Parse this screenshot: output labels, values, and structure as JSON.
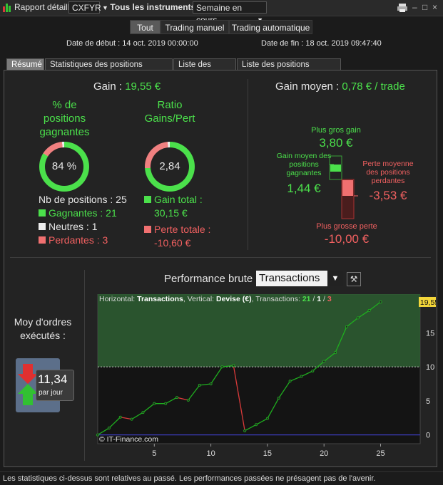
{
  "titlebar": {
    "title": "Rapport détaillé",
    "symbol": "CXFYR",
    "instruments": "Tous les instruments",
    "period": "Semaine en cours"
  },
  "filters": [
    "Tout",
    "Trading manuel",
    "Trading automatique"
  ],
  "dates": {
    "start": "Date de début : 14 oct. 2019 00:00:00",
    "end": "Date de fin : 18 oct. 2019 09:47:40"
  },
  "tabs": [
    "Résumé",
    "Statistiques des positions clôturées",
    "Liste des ordres",
    "Liste des positions clôturées"
  ],
  "summary": {
    "gain_label": "Gain :",
    "gain_value": "19,55 €",
    "pct_title": "% de positions gagnantes",
    "pct_value": "84 %",
    "pct_fraction": 0.84,
    "ratio_title": "Ratio Gains/Pert",
    "ratio_value": "2,84",
    "ratio_fraction": 0.74,
    "nb_positions": "Nb de positions : 25",
    "gagnantes": "Gagnantes : 21",
    "neutres": "Neutres : 1",
    "perdantes": "Perdantes : 3",
    "gain_total_label": "Gain total :",
    "gain_total_value": "30,15 €",
    "perte_totale_label": "Perte totale :",
    "perte_totale_value": "-10,60 €"
  },
  "gain_moyen": {
    "label": "Gain moyen :",
    "value": "0,78 € / trade",
    "plus_gros_gain_label": "Plus gros gain",
    "plus_gros_gain_value": "3,80 €",
    "gain_moyen_gagnantes_label": "Gain moyen des positions gagnantes",
    "gain_moyen_gagnantes_value": "1,44 €",
    "perte_moyenne_label": "Perte moyenne des positions perdantes",
    "perte_moyenne_value": "-3,53 €",
    "plus_grosse_perte_label": "Plus grosse perte",
    "plus_grosse_perte_value": "-10,00 €"
  },
  "moy_ordres": {
    "label": "Moy d'ordres exécutés :",
    "value": "11,34",
    "unit": "par jour"
  },
  "performance": {
    "label": "Performance brute",
    "select_value": "Transactions"
  },
  "chart_data": {
    "type": "line",
    "header_prefix": "Horizontal: ",
    "header_h": "Transactions",
    "header_mid": ", Vertical: ",
    "header_v": "Devise (€)",
    "header_tr": ", Transactions: ",
    "count_win": "21",
    "count_neutral": "1",
    "count_loss": "3",
    "watermark": "© IT-Finance.com",
    "x": [
      0,
      1,
      2,
      3,
      4,
      5,
      6,
      7,
      8,
      9,
      10,
      11,
      12,
      13,
      14,
      15,
      16,
      17,
      18,
      19,
      20,
      21,
      22,
      23,
      24,
      25
    ],
    "y": [
      0,
      1,
      2.6,
      2.3,
      3.3,
      4.6,
      4.6,
      5.5,
      5.1,
      7.3,
      7.5,
      10,
      10.2,
      0.6,
      1.5,
      2.4,
      5.4,
      7.9,
      8.6,
      9.4,
      10.8,
      12.1,
      15.9,
      17.2,
      18.3,
      19.55
    ],
    "loss_segments": [
      3,
      8,
      13
    ],
    "xlim": [
      0,
      28.5
    ],
    "ylim": [
      -1.3,
      20.7
    ],
    "x_ticks": [
      "5",
      "10",
      "15",
      "20",
      "25"
    ],
    "x_tick_values": [
      5,
      10,
      15,
      20,
      25
    ],
    "y_ticks": [
      "0",
      "5",
      "10",
      "15"
    ],
    "y_tick_values": [
      0,
      5,
      10,
      15
    ],
    "last_value_label": "19,55",
    "reference_line": 10,
    "colors": {
      "up": "#1fae1f",
      "down": "#d83a3a",
      "zone": "#2e5f32",
      "baseline": "#3c3cbf"
    }
  },
  "footer": "Les statistiques ci-dessus sont relatives au passé. Les performances passées ne présagent pas de l'avenir.",
  "colors": {
    "green": "#4be04b",
    "red": "#f06060",
    "ring_bg": "#f08080"
  }
}
